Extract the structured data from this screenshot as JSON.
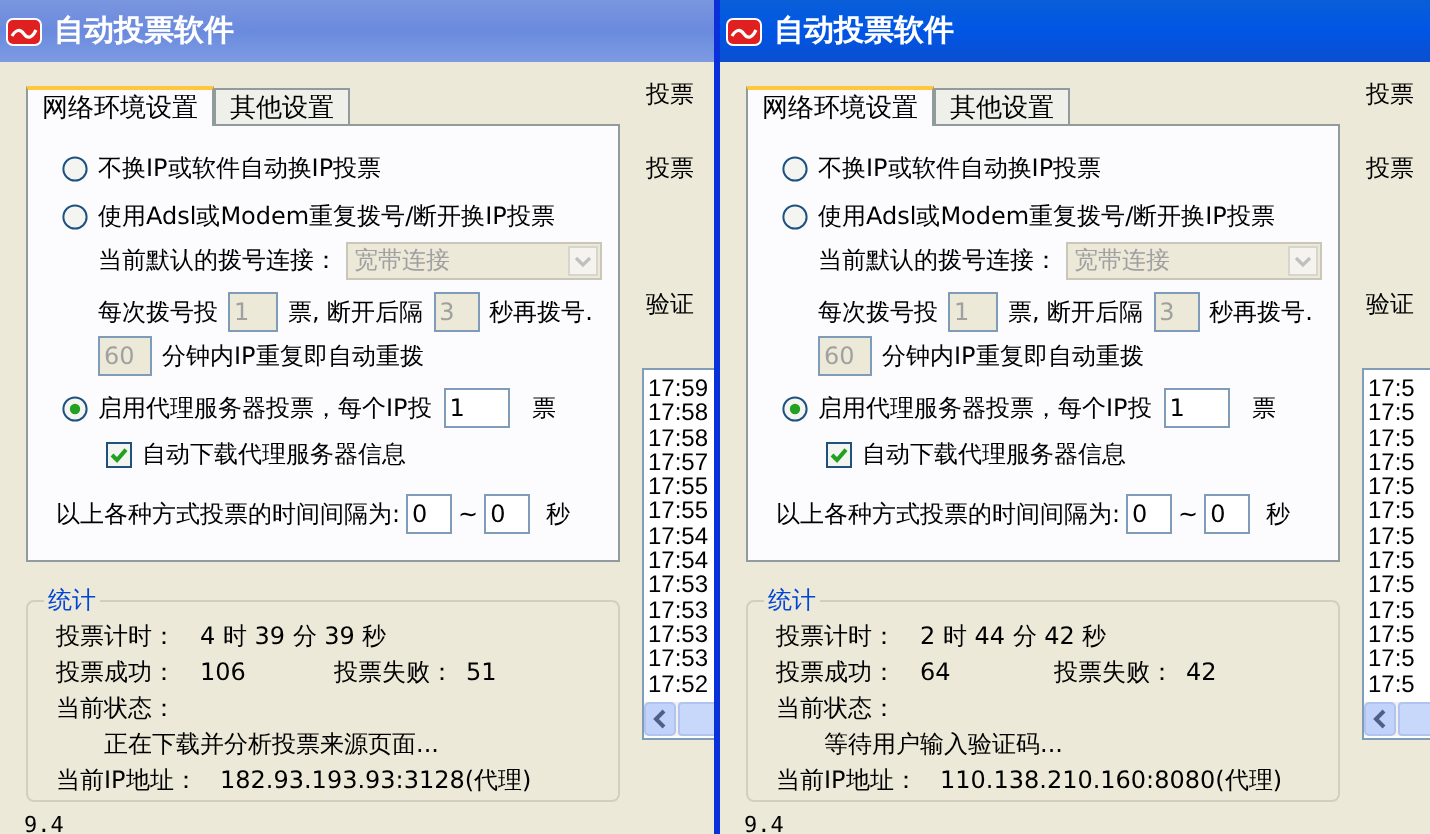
{
  "windows": [
    {
      "title": "自动投票软件",
      "active": false,
      "tabs": [
        {
          "label": "网络环境设置",
          "selected": true
        },
        {
          "label": "其他设置",
          "selected": false
        }
      ],
      "modes": [
        {
          "kind": "plain",
          "label": "不换IP或软件自动换IP投票",
          "selected": false
        },
        {
          "kind": "dial",
          "label": "使用Adsl或Modem重复拨号/断开换IP投票",
          "selected": false
        },
        {
          "kind": "proxy",
          "label": "启用代理服务器投票，每个IP投",
          "selected": true
        }
      ],
      "dial": {
        "disabled": true,
        "connection_label": "当前默认的拨号连接：",
        "connection": "宽带连接",
        "votes_prefix": "每次拨号投",
        "votes": "1",
        "votes_middle": "票, 断开后隔",
        "wait": "3",
        "wait_suffix": "秒再拨号.",
        "redial": "60",
        "redial_label": "分钟内IP重复即自动重拨"
      },
      "proxy": {
        "votes": "1",
        "unit": "票",
        "auto_download": {
          "label": "自动下载代理服务器信息",
          "checked": true
        }
      },
      "interval": {
        "label": "以上各种方式投票的时间间隔为:",
        "from": "0",
        "separator": "~",
        "to": "0",
        "unit": "秒"
      },
      "stats": {
        "title": "统计",
        "timer_label": "投票计时：",
        "timer": "4 时 39 分 39 秒",
        "success_label": "投票成功：",
        "success": "106",
        "fail_label": "投票失败：",
        "fail": "51",
        "status_label": "当前状态：",
        "status": "正在下载并分析投票来源页面...",
        "ip_label": "当前IP地址：",
        "ip": "182.93.193.93:3128(代理)"
      },
      "version": "9.4",
      "side_labels": [
        "投票",
        "投票",
        "验证"
      ],
      "log": [
        "17:59",
        "17:58",
        "17:58",
        "17:57",
        "17:55",
        "17:55",
        "17:54",
        "17:54",
        "17:53",
        "17:53",
        "17:53",
        "17:53",
        "17:52"
      ]
    },
    {
      "title": "自动投票软件",
      "active": true,
      "tabs": [
        {
          "label": "网络环境设置",
          "selected": true
        },
        {
          "label": "其他设置",
          "selected": false
        }
      ],
      "modes": [
        {
          "kind": "plain",
          "label": "不换IP或软件自动换IP投票",
          "selected": false
        },
        {
          "kind": "dial",
          "label": "使用Adsl或Modem重复拨号/断开换IP投票",
          "selected": false
        },
        {
          "kind": "proxy",
          "label": "启用代理服务器投票，每个IP投",
          "selected": true
        }
      ],
      "dial": {
        "disabled": true,
        "connection_label": "当前默认的拨号连接：",
        "connection": "宽带连接",
        "votes_prefix": "每次拨号投",
        "votes": "1",
        "votes_middle": "票, 断开后隔",
        "wait": "3",
        "wait_suffix": "秒再拨号.",
        "redial": "60",
        "redial_label": "分钟内IP重复即自动重拨"
      },
      "proxy": {
        "votes": "1",
        "unit": "票",
        "auto_download": {
          "label": "自动下载代理服务器信息",
          "checked": true
        }
      },
      "interval": {
        "label": "以上各种方式投票的时间间隔为:",
        "from": "0",
        "separator": "~",
        "to": "0",
        "unit": "秒"
      },
      "stats": {
        "title": "统计",
        "timer_label": "投票计时：",
        "timer": "2 时 44 分 42 秒",
        "success_label": "投票成功：",
        "success": "64",
        "fail_label": "投票失败：",
        "fail": "42",
        "status_label": "当前状态：",
        "status": "等待用户输入验证码...",
        "ip_label": "当前IP地址：",
        "ip": "110.138.210.160:8080(代理)"
      },
      "version": "9.4",
      "side_labels": [
        "投票",
        "投票",
        "验证"
      ],
      "log": [
        "17:5",
        "17:5",
        "17:5",
        "17:5",
        "17:5",
        "17:5",
        "17:5",
        "17:5",
        "17:5",
        "17:5",
        "17:5",
        "17:5",
        "17:5"
      ]
    }
  ]
}
